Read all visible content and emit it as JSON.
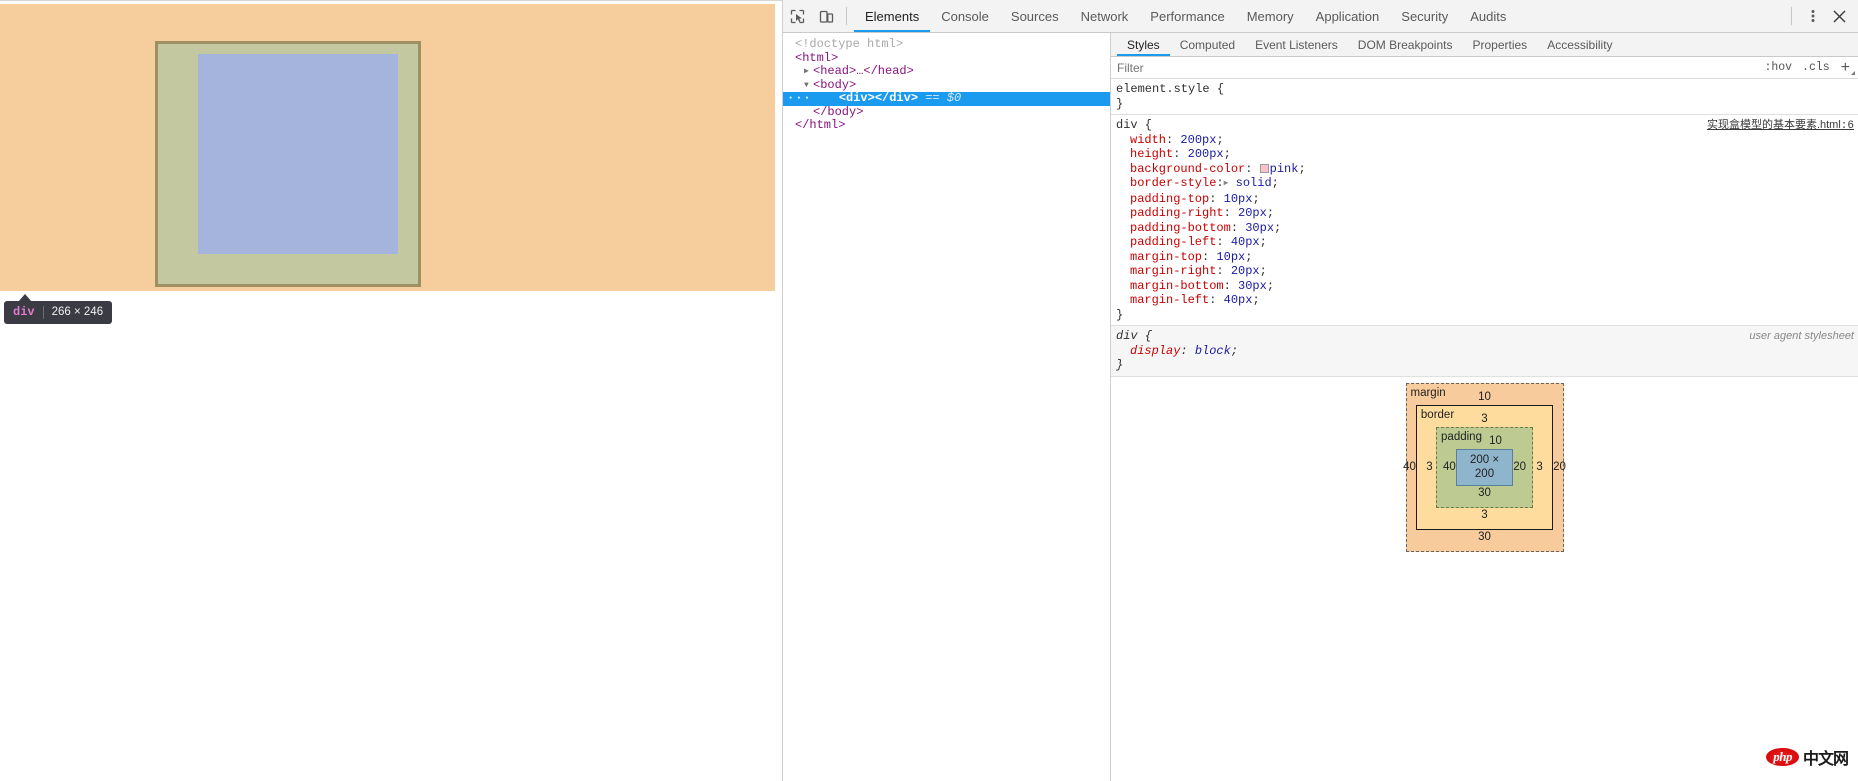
{
  "viewport": {
    "highlight": {
      "tag": "div",
      "dimensions": "266 × 246",
      "margin_color": "#f6cd9d",
      "border_color": "#9f9061",
      "padding_color": "#c3c8a1",
      "content_color": "#a4b4dd"
    }
  },
  "devtools": {
    "toolbar": {
      "inspect_icon": "inspect-cursor-icon",
      "device_icon": "device-toolbar-icon",
      "tabs": [
        {
          "label": "Elements",
          "active": true
        },
        {
          "label": "Console",
          "active": false
        },
        {
          "label": "Sources",
          "active": false
        },
        {
          "label": "Network",
          "active": false
        },
        {
          "label": "Performance",
          "active": false
        },
        {
          "label": "Memory",
          "active": false
        },
        {
          "label": "Application",
          "active": false
        },
        {
          "label": "Security",
          "active": false
        },
        {
          "label": "Audits",
          "active": false
        }
      ],
      "more_icon": "kebab-menu-icon",
      "close_icon": "close-icon"
    },
    "dom": {
      "rows": [
        {
          "indent": 0,
          "tri": "",
          "text": "<!doctype html>",
          "kind": "doctype"
        },
        {
          "indent": 0,
          "tri": "",
          "text": "<html>",
          "kind": "tag"
        },
        {
          "indent": 1,
          "tri": "▶",
          "text": "<head>…</head>",
          "kind": "tag"
        },
        {
          "indent": 1,
          "tri": "▼",
          "text": "<body>",
          "kind": "tag"
        },
        {
          "indent": 2,
          "tri": "",
          "text": "<div></div>",
          "kind": "selected",
          "badge": "···",
          "suffix": "== $0"
        },
        {
          "indent": 2,
          "tri": "",
          "text": "</body>",
          "kind": "tag"
        },
        {
          "indent": 0,
          "tri": "",
          "text": "</html>",
          "kind": "tag"
        }
      ]
    },
    "styles": {
      "tabs": [
        {
          "label": "Styles",
          "active": true
        },
        {
          "label": "Computed",
          "active": false
        },
        {
          "label": "Event Listeners",
          "active": false
        },
        {
          "label": "DOM Breakpoints",
          "active": false
        },
        {
          "label": "Properties",
          "active": false
        },
        {
          "label": "Accessibility",
          "active": false
        }
      ],
      "filter_placeholder": "Filter",
      "filter_value": "",
      "hov_label": ":hov",
      "cls_label": ".cls",
      "new_rule_label": "+",
      "rules": [
        {
          "selector": "element.style {",
          "close": "}",
          "origin": "",
          "origin_is_link": false,
          "declarations": []
        },
        {
          "selector": "div {",
          "close": "}",
          "origin": "实现盒模型的基本要素.html",
          "origin_line": ":6",
          "origin_is_link": true,
          "declarations": [
            {
              "prop": "width",
              "value": "200px",
              "swatch": false,
              "shape": false
            },
            {
              "prop": "height",
              "value": "200px",
              "swatch": false,
              "shape": false
            },
            {
              "prop": "background-color",
              "value": "pink",
              "swatch": true,
              "swatch_color": "#ffc0cb",
              "shape": false
            },
            {
              "prop": "border-style",
              "value": "solid",
              "swatch": false,
              "shape": true
            },
            {
              "prop": "padding-top",
              "value": "10px",
              "swatch": false,
              "shape": false
            },
            {
              "prop": "padding-right",
              "value": "20px",
              "swatch": false,
              "shape": false
            },
            {
              "prop": "padding-bottom",
              "value": "30px",
              "swatch": false,
              "shape": false
            },
            {
              "prop": "padding-left",
              "value": "40px",
              "swatch": false,
              "shape": false
            },
            {
              "prop": "margin-top",
              "value": "10px",
              "swatch": false,
              "shape": false
            },
            {
              "prop": "margin-right",
              "value": "20px",
              "swatch": false,
              "shape": false
            },
            {
              "prop": "margin-bottom",
              "value": "30px",
              "swatch": false,
              "shape": false
            },
            {
              "prop": "margin-left",
              "value": "40px",
              "swatch": false,
              "shape": false
            }
          ]
        },
        {
          "selector": "div {",
          "close": "}",
          "origin": "user agent stylesheet",
          "origin_is_link": false,
          "user_agent": true,
          "declarations": [
            {
              "prop": "display",
              "value": "block",
              "swatch": false,
              "shape": false
            }
          ]
        }
      ]
    },
    "box_model": {
      "margin_label": "margin",
      "border_label": "border",
      "padding_label": "padding",
      "content_label": "200 × 200",
      "margin": {
        "top": "10",
        "right": "20",
        "bottom": "30",
        "left": "40"
      },
      "border": {
        "top": "3",
        "right": "3",
        "bottom": "3",
        "left": "3"
      },
      "padding": {
        "top": "10",
        "right": "20",
        "bottom": "30",
        "left": "40"
      },
      "colors": {
        "margin": "#f8cb9c",
        "border": "#fddc9e",
        "padding": "#bdcb93",
        "content": "#8fb5cd"
      }
    }
  },
  "watermark": {
    "php": "php",
    "cn": "中文网"
  }
}
